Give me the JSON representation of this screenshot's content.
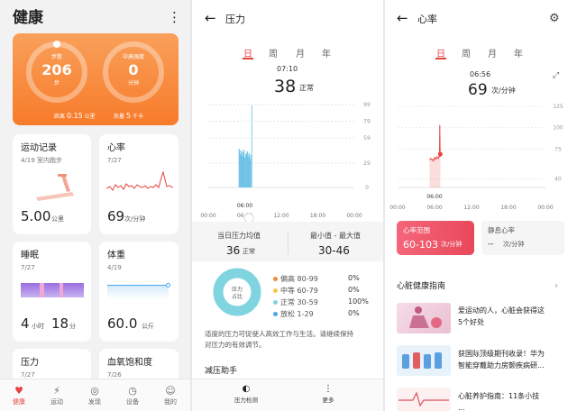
{
  "health": {
    "title": "健康",
    "top_card": {
      "steps_label": "步数",
      "steps_value": "206",
      "steps_unit": "步",
      "intensity_label": "中高强度",
      "intensity_value": "0",
      "intensity_unit": "分钟",
      "distance_prefix": "距离",
      "distance_value": "0.15",
      "distance_unit": "公里",
      "heat_prefix": "热量",
      "heat_value": "5",
      "heat_unit": "千卡"
    },
    "exercise": {
      "title": "运动记录",
      "subtitle": "4/19 室内跑步",
      "value": "5.00",
      "unit": "公里"
    },
    "heart": {
      "title": "心率",
      "date": "7/27",
      "value": "69",
      "unit": "次/分钟"
    },
    "sleep": {
      "title": "睡眠",
      "date": "7/27",
      "hours": "4",
      "hours_unit": "小时",
      "minutes": "18",
      "minutes_unit": "分"
    },
    "weight": {
      "title": "体重",
      "date": "4/19",
      "value": "60.0",
      "unit": "公斤"
    },
    "pressure": {
      "title": "压力",
      "date": "7/27"
    },
    "oxygen": {
      "title": "血氧饱和度",
      "date": "7/26"
    },
    "nav": [
      {
        "label": "健康",
        "icon": "heart-pulse-icon"
      },
      {
        "label": "运动",
        "icon": "runner-icon"
      },
      {
        "label": "发现",
        "icon": "discover-icon"
      },
      {
        "label": "设备",
        "icon": "watch-icon"
      },
      {
        "label": "我的",
        "icon": "person-icon"
      }
    ],
    "colors": {
      "accent": "#e64340",
      "orange": "#f77b2a"
    }
  },
  "stress": {
    "title": "压力",
    "tabs": [
      "日",
      "周",
      "月",
      "年"
    ],
    "time": "07:10",
    "value": "38",
    "level": "正常",
    "y_ticks": [
      "99",
      "79",
      "59",
      "29",
      "0"
    ],
    "x_ticks": [
      "00:00",
      "06:00",
      "12:00",
      "18:00",
      "00:00"
    ],
    "marker_time": "06:00",
    "avg_label": "当日压力均值",
    "avg_value": "36",
    "avg_level": "正常",
    "range_label": "最小值 - 最大值",
    "range_value": "30-46",
    "donut_label": "压力\n占比",
    "legend": [
      {
        "label": "偏高 80-99",
        "pct": "0%",
        "color": "#f08a3c"
      },
      {
        "label": "中等 60-79",
        "pct": "0%",
        "color": "#f7c64a"
      },
      {
        "label": "正常 30-59",
        "pct": "100%",
        "color": "#7fd4e0"
      },
      {
        "label": "放松 1-29",
        "pct": "0%",
        "color": "#4aa8e8"
      }
    ],
    "shares": [
      0,
      0,
      100,
      0
    ],
    "desc_line1": "适度的压力可促使人高效工作与生活。请继续保持",
    "desc_line2": "对压力的有效调节。",
    "section": "减压助手",
    "bottom_left": "压力检测",
    "bottom_right": "更多"
  },
  "heartrate": {
    "title": "心率",
    "tabs": [
      "日",
      "周",
      "月",
      "年"
    ],
    "time": "06:56",
    "value": "69",
    "unit": "次/分钟",
    "y_ticks": [
      "125",
      "100",
      "75",
      "40"
    ],
    "x_ticks": [
      "00:00",
      "06:00",
      "12:00",
      "18:00",
      "00:00"
    ],
    "marker_time": "06:00",
    "range_label": "心率范围",
    "range_value": "60-103",
    "range_unit": "次/分钟",
    "resting_label": "静息心率",
    "resting_value": "--",
    "resting_unit": "次/分钟",
    "guide_title": "心脏健康指南",
    "articles": [
      {
        "line1": "爱运动的人，心脏会获得这",
        "line2": "5个好处"
      },
      {
        "line1": "获国际顶级期刊收录！华为",
        "line2": "智能穿戴助力房颤疾病研..."
      },
      {
        "line1": "心脏养护指南：11条小技",
        "line2": "..."
      }
    ]
  },
  "chart_data": [
    {
      "type": "bar",
      "title": "",
      "x": [
        5.1,
        5.25,
        5.4,
        5.55,
        5.7,
        5.85,
        6.0,
        6.2,
        6.4,
        6.55,
        6.7,
        6.85,
        7.0,
        7.17
      ],
      "values": [
        46,
        40,
        44,
        38,
        42,
        45,
        36,
        40,
        43,
        37,
        41,
        34,
        39,
        98
      ],
      "y_ticks": [
        0,
        29,
        59,
        79,
        99
      ],
      "ylim": [
        0,
        99
      ],
      "xlim": [
        0,
        24
      ],
      "x_ticks": [
        "00:00",
        "06:00",
        "12:00",
        "18:00",
        "00:00"
      ],
      "grid": true
    },
    {
      "type": "area",
      "title": "",
      "x": [
        5.2,
        5.4,
        5.6,
        5.8,
        6.0,
        6.2,
        6.4,
        6.6,
        6.8,
        6.85,
        6.9,
        6.93
      ],
      "values": [
        62,
        64,
        63,
        61,
        65,
        63,
        66,
        64,
        67,
        103,
        66,
        69
      ],
      "y_ticks": [
        40,
        75,
        100,
        125
      ],
      "ylim": [
        30,
        125
      ],
      "xlim": [
        0,
        24
      ],
      "x_ticks": [
        "00:00",
        "06:00",
        "12:00",
        "18:00",
        "00:00"
      ],
      "grid": true
    }
  ]
}
